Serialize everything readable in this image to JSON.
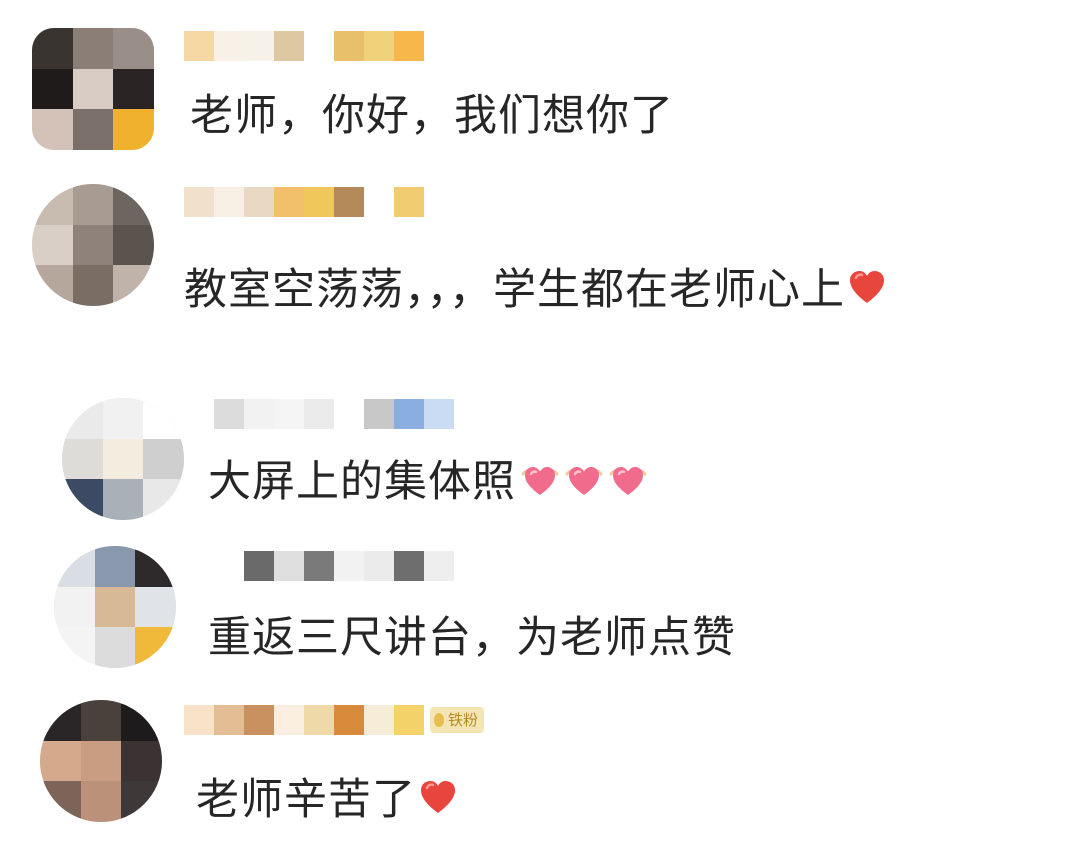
{
  "comments": [
    {
      "text": "老师，你好，我们想你了",
      "emoji": [],
      "avatar_colors": [
        "#3a3431",
        "#8a7e77",
        "#9a8f88",
        "#1f1b1a",
        "#d9ccc5",
        "#2a2424",
        "#d4c2b8",
        "#7b6f6a",
        "#f0b12e"
      ],
      "name_colors": [
        "#f5d8a4",
        "#f8f1e8",
        "#f6f2ea",
        "#ddc8a2",
        "#ffffff",
        "#e8c06a",
        "#efd27a",
        "#f6b84a"
      ]
    },
    {
      "text": "教室空荡荡，，，学生都在老师心上",
      "emoji": [
        "red-heart"
      ],
      "avatar_colors": [
        "#c8bcb1",
        "#a89c92",
        "#6d6560",
        "#d9cfc6",
        "#8e827a",
        "#5b534e",
        "#b5a79c",
        "#7a6d63",
        "#c0b4aa"
      ],
      "name_colors": [
        "#f1e0cc",
        "#f7eee4",
        "#e9d8c3",
        "#f2c06a",
        "#f0c75a",
        "#b48a5a",
        "#ffffff",
        "#f0cb6f"
      ]
    },
    {
      "text": "大屏上的集体照",
      "emoji": [
        "heart-wings",
        "heart-wings",
        "heart-wings"
      ],
      "avatar_colors": [
        "#eaeaea",
        "#f1f1f1",
        "#ffffff",
        "#dedcd9",
        "#f4ecdf",
        "#cfcfcf",
        "#3c4a63",
        "#aab0b7",
        "#e8e8e8"
      ],
      "name_colors": [
        "#dcdcdc",
        "#f2f2f2",
        "#f5f5f5",
        "#ebebeb",
        "#ffffff",
        "#c8c8c8",
        "#8aaee0",
        "#c9dcf4"
      ]
    },
    {
      "text": "重返三尺讲台，为老师点赞",
      "emoji": [],
      "avatar_colors": [
        "#d9dde4",
        "#8a98ad",
        "#2e2a2b",
        "#f2f2f2",
        "#d7b995",
        "#e0e4e8",
        "#f4f4f4",
        "#dcdcdc",
        "#f0b93a"
      ],
      "name_colors": [
        "#ffffff",
        "#6a6a6a",
        "#dedede",
        "#7a7a7a",
        "#f2f2f2",
        "#ebebeb",
        "#6e6e6e",
        "#eeeeee"
      ]
    },
    {
      "text": "老师辛苦了",
      "emoji": [
        "red-heart"
      ],
      "avatar_colors": [
        "#2a2627",
        "#4a403c",
        "#1e1b1c",
        "#d4a98c",
        "#c99d81",
        "#3a3233",
        "#7c6558",
        "#bb9179",
        "#3f3838"
      ],
      "name_colors": [
        "#f8e2c8",
        "#e3be94",
        "#c8915f",
        "#faeee0",
        "#f0d9a8",
        "#d98b3c",
        "#f7ecd8",
        "#f3d26a"
      ],
      "badge": "铁粉"
    }
  ]
}
